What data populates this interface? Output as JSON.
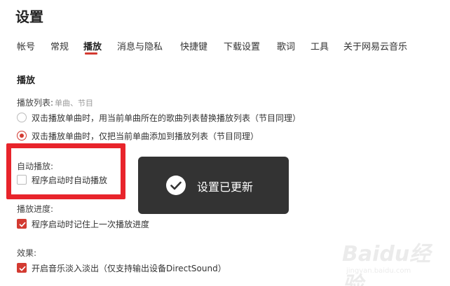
{
  "page": {
    "title": "设置"
  },
  "tabs": [
    {
      "label": "帐号",
      "active": false
    },
    {
      "label": "常规",
      "active": false
    },
    {
      "label": "播放",
      "active": true
    },
    {
      "label": "消息与隐私",
      "active": false
    },
    {
      "label": "快捷键",
      "active": false
    },
    {
      "label": "下载设置",
      "active": false
    },
    {
      "label": "歌词",
      "active": false
    },
    {
      "label": "工具",
      "active": false
    },
    {
      "label": "关于网易云音乐",
      "active": false
    }
  ],
  "section": {
    "title": "播放"
  },
  "playlist": {
    "label": "播放列表:",
    "hint": "单曲、节目",
    "options": [
      {
        "label": "双击播放单曲时，用当前单曲所在的歌曲列表替换播放列表（节目同理）",
        "checked": false
      },
      {
        "label": "双击播放单曲时，仅把当前单曲添加到播放列表（节目同理）",
        "checked": true
      }
    ]
  },
  "autoplay": {
    "label": "自动播放:",
    "option": {
      "label": "程序启动时自动播放",
      "checked": false
    }
  },
  "progress": {
    "label": "播放进度:",
    "option": {
      "label": "程序启动时记住上一次播放进度",
      "checked": true
    }
  },
  "effects": {
    "label": "效果:",
    "option": {
      "label": "开启音乐淡入淡出（仅支持输出设备DirectSound）",
      "checked": true
    }
  },
  "toast": {
    "message": "设置已更新",
    "icon": "check-circle-icon"
  },
  "watermark": {
    "logo": "Baidu经验",
    "url": "jingyan.baidu.com"
  },
  "colors": {
    "accent": "#d33a31",
    "highlight": "#e8242b",
    "toast_bg": "#333333"
  }
}
